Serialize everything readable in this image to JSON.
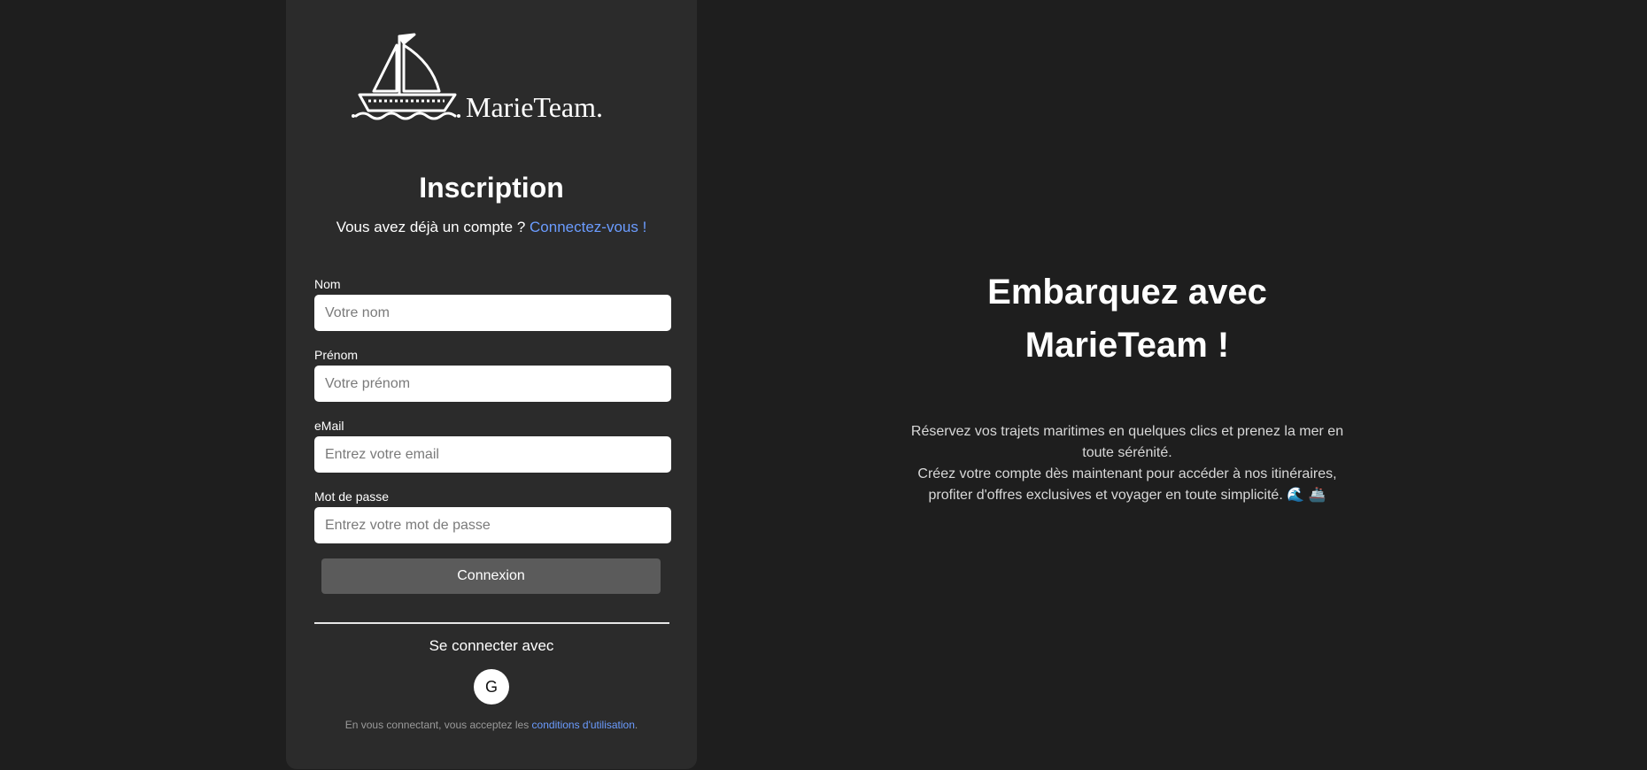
{
  "brand": {
    "name": "MarieTeam."
  },
  "form": {
    "title": "Inscription",
    "have_account_text": "Vous avez déjà un compte ?",
    "login_link": "Connectez-vous !",
    "fields": {
      "nom": {
        "label": "Nom",
        "placeholder": "Votre nom"
      },
      "prenom": {
        "label": "Prénom",
        "placeholder": "Votre prénom"
      },
      "email": {
        "label": "eMail",
        "placeholder": "Entrez votre email"
      },
      "password": {
        "label": "Mot de passe",
        "placeholder": "Entrez votre mot de passe"
      }
    },
    "submit_label": "Connexion",
    "social_label": "Se connecter avec",
    "google_label": "G",
    "terms_text": "En vous connectant, vous acceptez les",
    "terms_link": "conditions d'utilisation",
    "terms_end": "."
  },
  "hero": {
    "title_line1": "Embarquez avec",
    "title_line2": "MarieTeam !",
    "line1": "Réservez vos trajets maritimes en quelques clics et prenez la mer en toute sérénité.",
    "line2": "Créez votre compte dès maintenant pour accéder à nos itinéraires, profiter d'offres exclusives et voyager en toute simplicité. 🌊 🚢"
  },
  "colors": {
    "background": "#1e1e1e",
    "card": "#2b2b2b",
    "link": "#6b9cff",
    "button": "#5b5b5b"
  }
}
